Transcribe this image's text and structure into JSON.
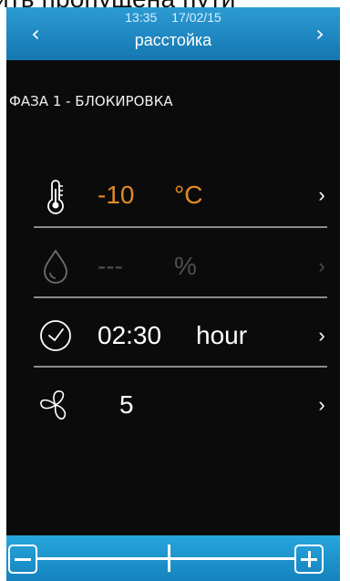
{
  "caption_text": "ить пропущена пути",
  "header": {
    "time": "13:35",
    "date": "17/02/15",
    "title": "расстойка",
    "back_arrow": "‹",
    "forward_arrow": "›"
  },
  "phase_label": "ФАЗА 1 - БЛОКИРОВКА",
  "rows": [
    {
      "icon": "thermometer-icon",
      "value": "-10",
      "unit": "°C",
      "chevron": "›",
      "color": "#e08a27",
      "enabled": true
    },
    {
      "icon": "humidity-drop-icon",
      "value": "---",
      "unit": "%",
      "chevron": "›",
      "color": "#4f4f4f",
      "enabled": false
    },
    {
      "icon": "clock-icon",
      "value": "02:30",
      "unit": "hour",
      "chevron": "›",
      "color": "#ffffff",
      "enabled": true
    },
    {
      "icon": "fan-icon",
      "value": "5",
      "unit": "",
      "chevron": "›",
      "color": "#ffffff",
      "enabled": true
    }
  ],
  "slider": {
    "decrease_icon": "minus-icon",
    "increase_icon": "plus-icon",
    "level": 0.51
  },
  "colors": {
    "bar_blue": "#1a86c1",
    "background": "#0b0b0b",
    "divider": "#8b8b8b"
  }
}
